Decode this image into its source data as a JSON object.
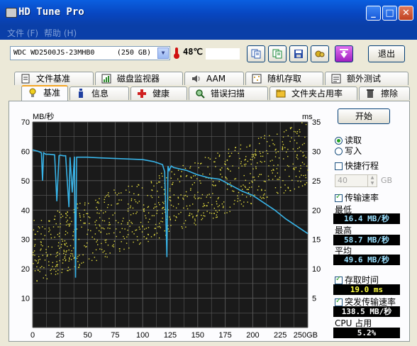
{
  "window": {
    "title": "HD Tune Pro",
    "minimize": "_",
    "maximize": "□",
    "close": "✕"
  },
  "menu": {
    "file": "文件 (F)",
    "help": "帮助 (H)"
  },
  "toolbar": {
    "drive_model": "WDC WD2500JS-23MHB0",
    "drive_capacity": "(250 GB)",
    "temperature": "48℃",
    "exit_label": "退出"
  },
  "tabs_top": [
    {
      "label": "文件基准",
      "icon": "file-benchmark-icon"
    },
    {
      "label": "磁盘监视器",
      "icon": "disk-monitor-icon"
    },
    {
      "label": "AAM",
      "icon": "speaker-icon"
    },
    {
      "label": "随机存取",
      "icon": "random-access-icon"
    },
    {
      "label": "额外测试",
      "icon": "extra-tests-icon"
    }
  ],
  "tabs_bottom": [
    {
      "label": "基准",
      "icon": "benchmark-icon",
      "active": true
    },
    {
      "label": "信息",
      "icon": "info-icon"
    },
    {
      "label": "健康",
      "icon": "health-cross-icon"
    },
    {
      "label": "错误扫描",
      "icon": "error-scan-icon"
    },
    {
      "label": "文件夹占用率",
      "icon": "folder-usage-icon"
    },
    {
      "label": "擦除",
      "icon": "erase-trash-icon"
    }
  ],
  "side": {
    "start_label": "开始",
    "read_label": "读取",
    "write_label": "写入",
    "mode": "read",
    "short_stroke_label": "快捷行程",
    "short_stroke_checked": false,
    "short_stroke_value": "40",
    "short_stroke_unit": "GB",
    "transfer_rate_label": "传输速率",
    "transfer_rate_checked": true,
    "min_label": "最低",
    "min_value": "16.4 MB/秒",
    "max_label": "最高",
    "max_value": "58.7 MB/秒",
    "avg_label": "平均",
    "avg_value": "49.6 MB/秒",
    "access_time_label": "存取时间",
    "access_time_checked": true,
    "access_time_value": "19.0 ms",
    "burst_label": "突发传输速率",
    "burst_checked": true,
    "burst_value": "138.5 MB/秒",
    "cpu_label": "CPU 占用",
    "cpu_value": "5.2%"
  },
  "colors": {
    "rate_line": "#38b4e8",
    "access_dots": "#e8e040",
    "plot_bg": "#1a1a1a",
    "grid": "#5a5a5a"
  },
  "chart_data": {
    "type": "line",
    "ylabel_left": "MB/秒",
    "ylabel_right": "ms",
    "ylim_left": [
      0,
      70
    ],
    "ylim_right": [
      0,
      35
    ],
    "xlim": [
      0,
      250
    ],
    "x_unit": "GB",
    "x_ticks": [
      "0",
      "25",
      "50",
      "75",
      "100",
      "125",
      "150",
      "175",
      "200",
      "225",
      "250GB"
    ],
    "y_ticks_left": [
      "10",
      "20",
      "30",
      "40",
      "50",
      "60",
      "70"
    ],
    "y_ticks_right": [
      "5",
      "10",
      "15",
      "20",
      "25",
      "30",
      "35"
    ],
    "grid": true,
    "series": [
      {
        "name": "传输速率",
        "axis": "left",
        "x": [
          0,
          5,
          8,
          9,
          10,
          12,
          15,
          20,
          22,
          24,
          25,
          28,
          30,
          33,
          34,
          36,
          38,
          39,
          40,
          42,
          44,
          45,
          50,
          60,
          80,
          100,
          110,
          118,
          120,
          122,
          123,
          124,
          126,
          128,
          140,
          150,
          160,
          170,
          180,
          190,
          200,
          210,
          220,
          230,
          240,
          250
        ],
        "y": [
          60.5,
          60,
          59.5,
          50,
          59.5,
          59,
          59,
          58.8,
          43,
          58.5,
          58.7,
          58.5,
          58.5,
          41,
          58,
          46,
          58.2,
          17,
          58,
          58,
          58,
          58,
          58,
          57.8,
          57.5,
          57.2,
          56.5,
          55.5,
          53,
          24,
          55,
          53.5,
          55,
          54.5,
          53.5,
          52,
          51,
          50.5,
          48.5,
          46.5,
          45,
          42.5,
          40,
          37,
          34.5,
          32
        ]
      }
    ],
    "access_time_trend": {
      "name": "存取时间",
      "axis": "right",
      "x_start": 0,
      "y_start_ms": 13,
      "x_end": 250,
      "y_end_ms": 30
    }
  }
}
